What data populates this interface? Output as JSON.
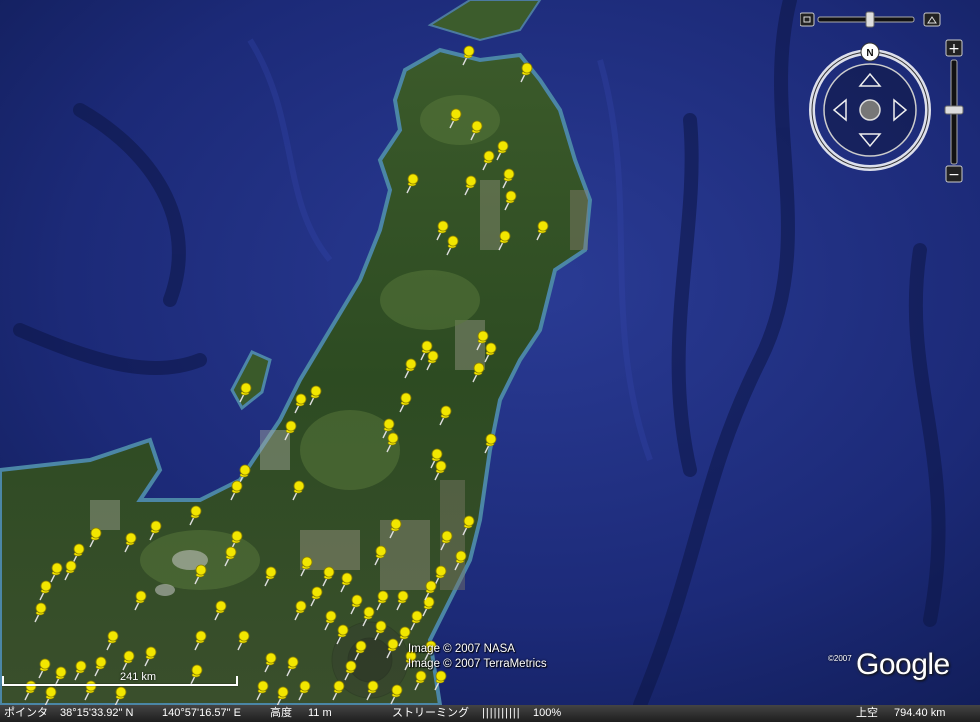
{
  "map": {
    "credits": [
      "Image © 2007 NASA",
      "Image © 2007 TerraMetrics"
    ],
    "scale_label": "241 km",
    "logo_copyright": "©2007",
    "logo_text": "Google",
    "compass_label": "N",
    "ocean_color": "#1f2f86",
    "land_color": "#2c4a1e",
    "pin_color": "#f2e600"
  },
  "status_bar": {
    "pointer_label": "ポインタ",
    "latitude": "38°15'33.92\" N",
    "longitude": "140°57'16.57\" E",
    "elevation_label": "高度",
    "elevation_value": "11 m",
    "streaming_label": "ストリーミング",
    "streaming_meter": "||||||||||",
    "streaming_percent": "100%",
    "altitude_label": "上空",
    "altitude_value": "794.40 km"
  },
  "controls": {
    "zoom_in": "+",
    "zoom_out": "−",
    "icons": [
      "tilt-flat-icon",
      "tilt-up-icon",
      "compass-ring-icon",
      "pan-joystick-icon",
      "zoom-slider-icon"
    ]
  }
}
